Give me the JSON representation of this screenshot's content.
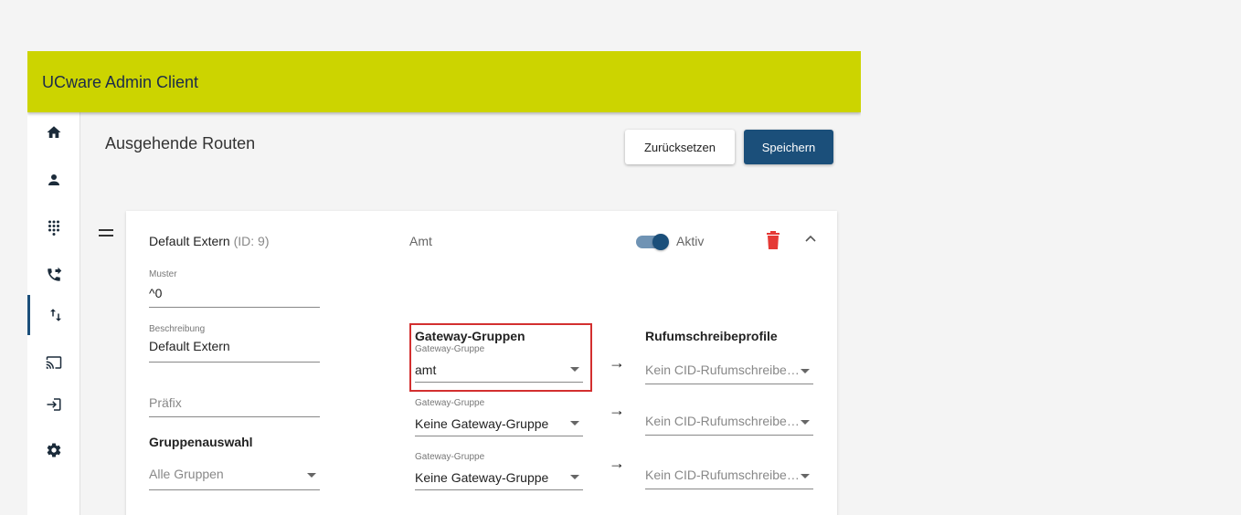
{
  "header": {
    "title": "UCware Admin Client"
  },
  "sidebar": {
    "items": [
      {
        "icon": "home-icon"
      },
      {
        "icon": "user-icon"
      },
      {
        "icon": "dialpad-icon"
      },
      {
        "icon": "phone-forward-icon"
      },
      {
        "icon": "routes-icon",
        "active": true
      },
      {
        "icon": "cast-icon"
      },
      {
        "icon": "login-icon"
      },
      {
        "icon": "gear-icon"
      }
    ]
  },
  "page": {
    "title": "Ausgehende Routen",
    "reset_label": "Zurücksetzen",
    "save_label": "Speichern"
  },
  "route": {
    "name": "Default Extern",
    "id_text": "(ID: 9)",
    "type": "Amt",
    "active_label": "Aktiv",
    "muster_label": "Muster",
    "muster_value": "^0",
    "beschreibung_label": "Beschreibung",
    "beschreibung_value": "Default Extern",
    "praefix_placeholder": "Präfix",
    "gruppenauswahl_title": "Gruppenauswahl",
    "gruppenauswahl_value": "Alle Gruppen",
    "gateway_title": "Gateway-Gruppen",
    "profile_title": "Rufumschreibeprofile",
    "gateway_rows": [
      {
        "label": "Gateway-Gruppe",
        "value": "amt",
        "profile": "Kein CID-Rufumschreibe…"
      },
      {
        "label": "Gateway-Gruppe",
        "value": "Keine Gateway-Gruppe",
        "profile": "Kein CID-Rufumschreibe…"
      },
      {
        "label": "Gateway-Gruppe",
        "value": "Keine Gateway-Gruppe",
        "profile": "Kein CID-Rufumschreibe…"
      }
    ],
    "arrow": "→"
  },
  "colors": {
    "header": "#ccd400",
    "primary": "#1b4f7a",
    "danger": "#e53935",
    "highlight": "#d32f2f"
  }
}
